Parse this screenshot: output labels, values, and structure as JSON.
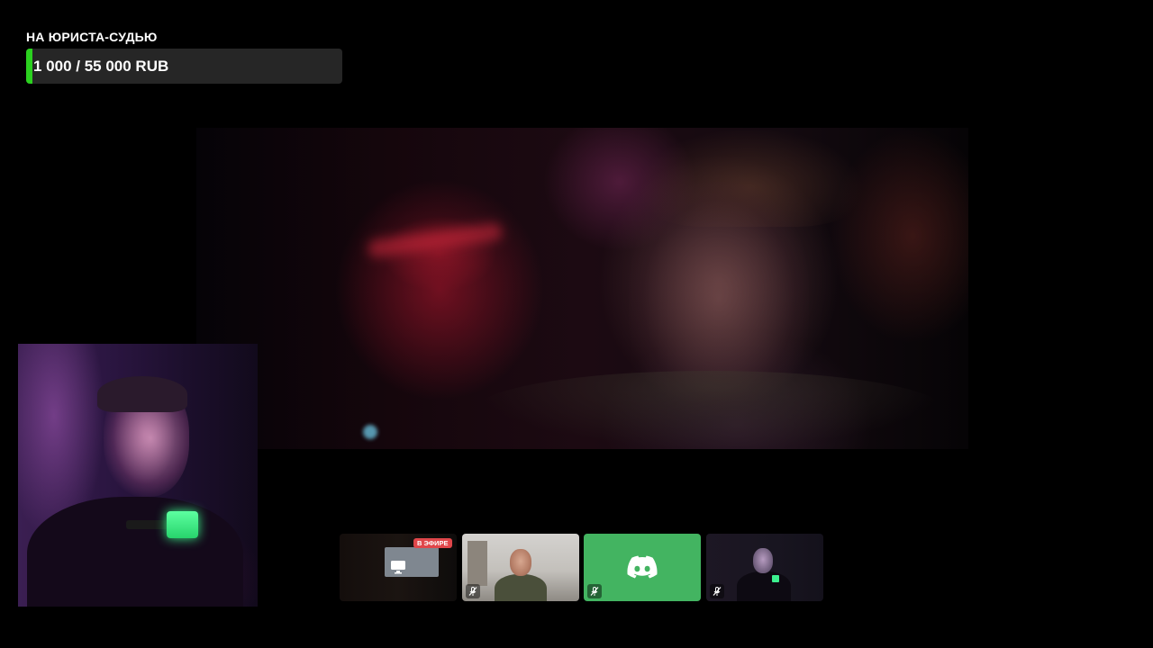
{
  "goal": {
    "title": "НА ЮРИСТА-СУДЬЮ",
    "amount_text": "1 000 / 55 000 RUB",
    "current": 1000,
    "target": 55000,
    "fill_color": "#2bd11f"
  },
  "main_video": {
    "content": "movie-frame"
  },
  "webcam": {
    "content": "streamer-webcam"
  },
  "discord": {
    "participants": [
      {
        "id": "screen-share",
        "live_badge": "В ЭФИРЕ",
        "icon": "monitor-icon"
      },
      {
        "id": "participant-2",
        "muted": true,
        "icon": "mic-muted-icon"
      },
      {
        "id": "participant-3",
        "muted": true,
        "avatar": "discord-logo-icon",
        "color": "#43b461"
      },
      {
        "id": "participant-4",
        "muted": true,
        "icon": "mic-muted-icon"
      }
    ]
  }
}
